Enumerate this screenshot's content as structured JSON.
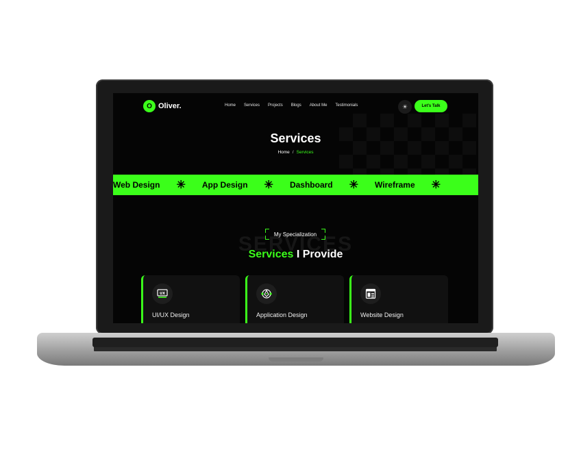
{
  "site": {
    "logo_initial": "O",
    "logo_text": "Oliver.",
    "nav": [
      "Home",
      "Services",
      "Projects",
      "Blogs",
      "About Me",
      "Testimonials"
    ],
    "theme_icon": "sun-icon",
    "cta_label": "Let's Talk"
  },
  "hero": {
    "title": "Services",
    "breadcrumb_home": "Home",
    "breadcrumb_sep": "/",
    "breadcrumb_current": "Services"
  },
  "band": {
    "items": [
      "Web Design",
      "App Design",
      "Dashboard",
      "Wireframe"
    ],
    "separator": "✳"
  },
  "section": {
    "ghost": "SERVICES",
    "badge": "My Specialization",
    "title_accent": "Services",
    "title_rest": "I Provide"
  },
  "cards": [
    {
      "label": "UI/UX Design",
      "icon": "ux-icon"
    },
    {
      "label": "Application Design",
      "icon": "pen-tool-icon"
    },
    {
      "label": "Website Design",
      "icon": "web-layout-icon"
    }
  ],
  "colors": {
    "accent": "#3bff1a",
    "background": "#050505"
  }
}
